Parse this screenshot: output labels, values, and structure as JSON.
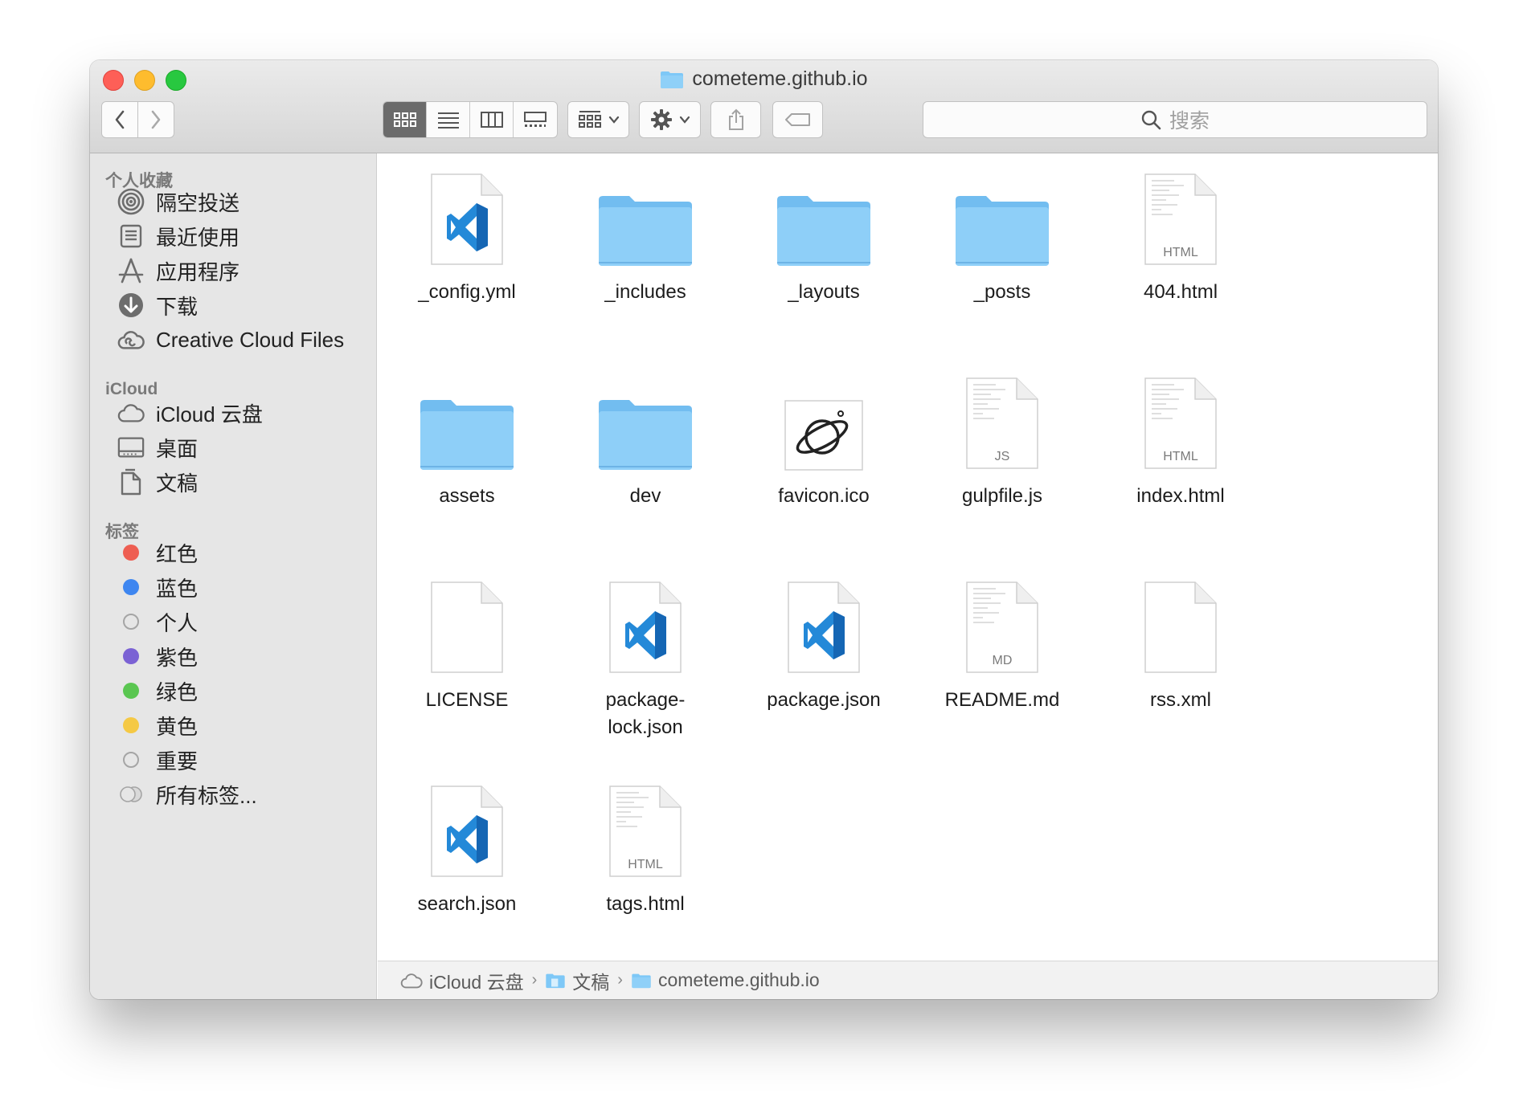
{
  "window": {
    "title": "cometeme.github.io"
  },
  "toolbar": {
    "search_placeholder": "搜索",
    "view_modes": [
      "icon-view-icon",
      "list-view-icon",
      "column-view-icon",
      "gallery-view-icon"
    ],
    "active_view": "icon-view-icon"
  },
  "sidebar": {
    "favorites_title": "个人收藏",
    "favorites": [
      {
        "label": "隔空投送",
        "icon": "airdrop-icon"
      },
      {
        "label": "最近使用",
        "icon": "recents-icon"
      },
      {
        "label": "应用程序",
        "icon": "applications-icon"
      },
      {
        "label": "下载",
        "icon": "downloads-icon"
      },
      {
        "label": "Creative Cloud Files",
        "icon": "creative-cloud-icon"
      }
    ],
    "icloud_title": "iCloud",
    "icloud": [
      {
        "label": "iCloud 云盘",
        "icon": "cloud-icon"
      },
      {
        "label": "桌面",
        "icon": "desktop-icon"
      },
      {
        "label": "文稿",
        "icon": "documents-icon"
      }
    ],
    "tags_title": "标签",
    "tags": [
      {
        "label": "红色",
        "color": "#ee5e52"
      },
      {
        "label": "蓝色",
        "color": "#3e86f0"
      },
      {
        "label": "个人",
        "color": "#e6e6e6"
      },
      {
        "label": "紫色",
        "color": "#7b62d4"
      },
      {
        "label": "绿色",
        "color": "#5ac651"
      },
      {
        "label": "黄色",
        "color": "#f5c945"
      },
      {
        "label": "重要",
        "color": "#e6e6e6"
      },
      {
        "label": "所有标签...",
        "color": "#d0d0d0"
      }
    ]
  },
  "files": [
    {
      "name": "_config.yml",
      "kind": "vscode"
    },
    {
      "name": "_includes",
      "kind": "folder"
    },
    {
      "name": "_layouts",
      "kind": "folder"
    },
    {
      "name": "_posts",
      "kind": "folder"
    },
    {
      "name": "404.html",
      "kind": "doc",
      "badge": "HTML"
    },
    {
      "name": "assets",
      "kind": "folder"
    },
    {
      "name": "dev",
      "kind": "folder"
    },
    {
      "name": "favicon.ico",
      "kind": "favicon"
    },
    {
      "name": "gulpfile.js",
      "kind": "doc",
      "badge": "JS"
    },
    {
      "name": "index.html",
      "kind": "doc",
      "badge": "HTML"
    },
    {
      "name": "LICENSE",
      "kind": "blank"
    },
    {
      "name": "package-\nlock.json",
      "kind": "vscode"
    },
    {
      "name": "package.json",
      "kind": "vscode"
    },
    {
      "name": "README.md",
      "kind": "doc",
      "badge": "MD"
    },
    {
      "name": "rss.xml",
      "kind": "blank"
    },
    {
      "name": "search.json",
      "kind": "vscode"
    },
    {
      "name": "tags.html",
      "kind": "doc",
      "badge": "HTML"
    }
  ],
  "pathbar": {
    "segments": [
      {
        "label": "iCloud 云盘",
        "icon": "cloud-icon"
      },
      {
        "label": "文稿",
        "icon": "documents-folder-icon"
      },
      {
        "label": "cometeme.github.io",
        "icon": "folder-icon"
      }
    ],
    "separator": "›"
  },
  "colors": {
    "folder": "#7ec8f7",
    "vscode_blue": "#1f7ad3",
    "active_segment": "#6b6b6b"
  }
}
